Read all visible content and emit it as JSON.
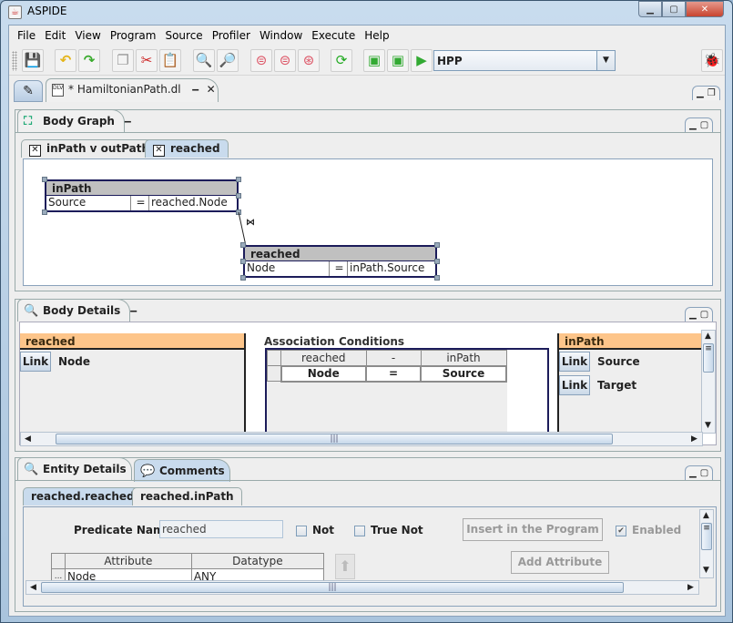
{
  "window": {
    "title": "ASPIDE",
    "minimize_icon": "minimize-icon",
    "maximize_icon": "maximize-icon",
    "close_icon": "close-icon"
  },
  "menubar": {
    "items": [
      "File",
      "Edit",
      "View",
      "Program",
      "Source",
      "Profiler",
      "Window",
      "Execute",
      "Help"
    ]
  },
  "toolbar": {
    "buttons": [
      {
        "name": "save",
        "icon": "floppy-disk-icon"
      },
      {
        "name": "undo",
        "icon": "undo-arrow-icon"
      },
      {
        "name": "redo",
        "icon": "redo-arrow-icon"
      },
      {
        "name": "copy",
        "icon": "copy-icon"
      },
      {
        "name": "cut",
        "icon": "scissors-icon"
      },
      {
        "name": "paste",
        "icon": "clipboard-icon"
      },
      {
        "name": "find",
        "icon": "magnifier-icon"
      },
      {
        "name": "find-replace",
        "icon": "magnifier-arrow-icon"
      },
      {
        "name": "add-rule",
        "icon": "rule-single-icon"
      },
      {
        "name": "add-rules",
        "icon": "rule-double-icon"
      },
      {
        "name": "add-rule-group",
        "icon": "rule-triple-icon"
      },
      {
        "name": "refresh",
        "icon": "refresh-icon"
      },
      {
        "name": "run-config",
        "icon": "run-list-icon"
      },
      {
        "name": "debug",
        "icon": "run-bug-icon"
      },
      {
        "name": "run",
        "icon": "run-play-icon"
      }
    ],
    "run_config_selected": "HPP",
    "debug_tool_icon": "bug-icon"
  },
  "doc_tabs": {
    "editor_icon": "pencil-icon",
    "file_tab_label": "* HamiltonianPath.dl",
    "file_icon": "dlv-file-icon"
  },
  "body_graph": {
    "tab_label": "Body Graph",
    "icon": "graph-nodes-icon",
    "subtabs": [
      {
        "label": "inPath v outPath",
        "active": false
      },
      {
        "label": "reached",
        "active": true
      }
    ],
    "nodes": [
      {
        "name": "inPath",
        "attr": "Source",
        "op": "=",
        "value": "reached.Node"
      },
      {
        "name": "reached",
        "attr": "Node",
        "op": "=",
        "value": "inPath.Source"
      }
    ],
    "join_symbol": "⋈"
  },
  "body_details": {
    "tab_label": "Body Details",
    "icon": "magnifier-details-icon",
    "left_entity": {
      "name": "reached",
      "rows": [
        {
          "link": "Link",
          "attr": "Node"
        }
      ]
    },
    "association": {
      "title": "Association Conditions",
      "headers": [
        "reached",
        "-",
        "inPath"
      ],
      "rows": [
        [
          "Node",
          "=",
          "Source"
        ]
      ]
    },
    "right_entity": {
      "name": "inPath",
      "rows": [
        {
          "link": "Link",
          "attr": "Source"
        },
        {
          "link": "Link",
          "attr": "Target"
        }
      ]
    }
  },
  "entity_details": {
    "tab_label": "Entity Details",
    "icon": "magnifier-entity-icon",
    "comments_tab_label": "Comments",
    "comments_icon": "speech-bubble-icon",
    "subtabs": [
      {
        "label": "reached.reached",
        "active": true
      },
      {
        "label": "reached.inPath",
        "active": false
      }
    ],
    "predicate_label": "Predicate Name",
    "predicate_value": "reached",
    "not_label": "Not",
    "not_checked": false,
    "true_not_label": "True Not",
    "true_not_checked": false,
    "insert_button": "Insert in the Program",
    "enabled_label": "Enabled",
    "enabled_checked": true,
    "add_attribute_button": "Add Attribute",
    "table": {
      "headers": [
        "Attribute",
        "Datatype"
      ],
      "rows": [
        {
          "marker": "...",
          "attribute": "Node",
          "datatype": "ANY"
        }
      ]
    },
    "move_up_icon": "arrow-up-icon"
  }
}
